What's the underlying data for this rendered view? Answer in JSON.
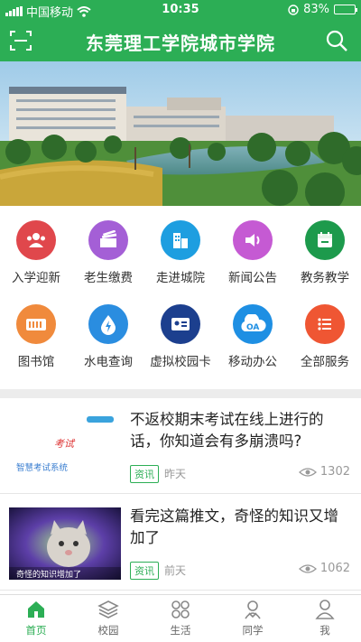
{
  "status": {
    "carrier": "中国移动",
    "time": "10:35",
    "battery": "83%",
    "battery_level": 0.83
  },
  "header": {
    "title": "东莞理工学院城市学院"
  },
  "grid": [
    {
      "label": "入学迎新",
      "color": "#e0474c",
      "icon": "users-icon"
    },
    {
      "label": "老生缴费",
      "color": "#a45fd6",
      "icon": "money-icon"
    },
    {
      "label": "走进城院",
      "color": "#1e9ee0",
      "icon": "building-icon"
    },
    {
      "label": "新闻公告",
      "color": "#c55ad3",
      "icon": "speaker-icon"
    },
    {
      "label": "教务教学",
      "color": "#1d9a4c",
      "icon": "calendar-icon"
    },
    {
      "label": "图书馆",
      "color": "#f08a3c",
      "icon": "library-icon"
    },
    {
      "label": "水电查询",
      "color": "#2a8de0",
      "icon": "utility-icon"
    },
    {
      "label": "虚拟校园卡",
      "color": "#1c3f8e",
      "icon": "id-card-icon"
    },
    {
      "label": "移动办公",
      "color": "#1e8fe3",
      "icon": "oa-cloud-icon"
    },
    {
      "label": "全部服务",
      "color": "#ef5633",
      "icon": "menu-icon"
    }
  ],
  "grid_oa_text": "OA",
  "feed": [
    {
      "headline": "不返校期末考试在线上进行的话，你知道会有多崩溃吗?",
      "tag": "资讯",
      "time": "昨天",
      "views": "1302",
      "thumb_caption": "智慧考试系统"
    },
    {
      "headline": "看完这篇推文，奇怪的知识又增加了",
      "tag": "资讯",
      "time": "前天",
      "views": "1062",
      "thumb_caption": "奇怪的知识增加了"
    }
  ],
  "tabs": [
    {
      "label": "首页",
      "icon": "home-icon",
      "active": true
    },
    {
      "label": "校园",
      "icon": "layers-icon",
      "active": false
    },
    {
      "label": "生活",
      "icon": "grid-icon",
      "active": false
    },
    {
      "label": "同学",
      "icon": "classmates-icon",
      "active": false
    },
    {
      "label": "我",
      "icon": "person-icon",
      "active": false
    }
  ],
  "colors": {
    "brand": "#2cae55"
  }
}
